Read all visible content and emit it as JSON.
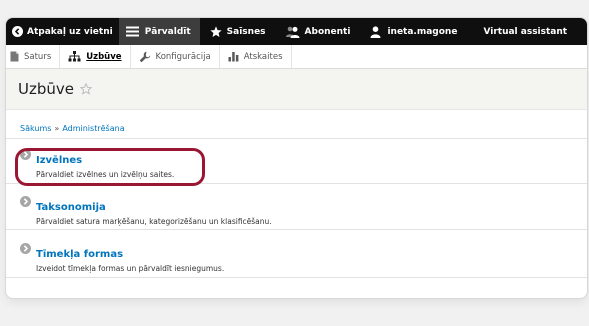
{
  "toolbar": {
    "back_label": "Atpakaļ uz vietni",
    "manage_label": "Pārvaldīt",
    "shortcuts_label": "Saīsnes",
    "people_label": "Abonenti",
    "user_label": "ineta.magone",
    "assistant_label": "Virtual assistant"
  },
  "tray": {
    "items": [
      {
        "label": "Saturs",
        "icon": "file-icon"
      },
      {
        "label": "Uzbūve",
        "icon": "structure-icon",
        "active": true
      },
      {
        "label": "Konfigurācija",
        "icon": "wrench-icon"
      },
      {
        "label": "Atskaites",
        "icon": "bar-chart-icon"
      }
    ]
  },
  "header": {
    "title": "Uzbūve"
  },
  "breadcrumb": {
    "home": "Sākums",
    "separator": "»",
    "admin": "Administrēšana"
  },
  "items": [
    {
      "title": "Izvēlnes",
      "description": "Pārvaldiet izvēlnes un izvēlņu saites."
    },
    {
      "title": "Taksonomija",
      "description": "Pārvaldiet satura marķēšanu, kategorizēšanu un klasificēšanu."
    },
    {
      "title": "Tīmekļa formas",
      "description": "Izveidot tīmekļa formas un pārvaldīt iesniegumus."
    }
  ],
  "colors": {
    "toolbar_bg": "#0f0f0f",
    "toolbar_active": "#3d3d3d",
    "link": "#0074bd",
    "highlight": "#9a1633",
    "header_bg": "#f4f4f1"
  }
}
